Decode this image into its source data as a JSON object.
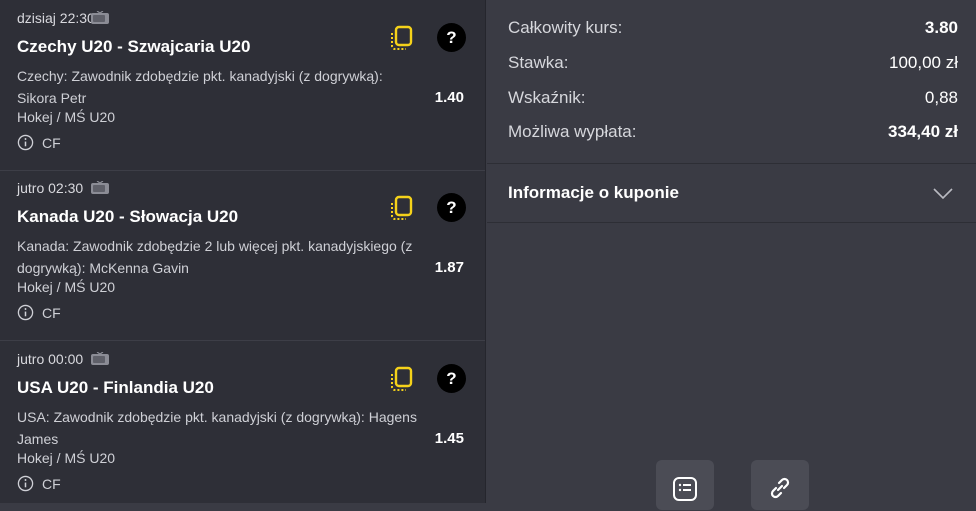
{
  "bets": [
    {
      "time": "dzisiaj 22:30",
      "title": "Czechy U20 - Szwajcaria U20",
      "desc": "Czechy: Zawodnik zdobędzie pkt. kanadyjski (z dogrywką): Sikora Petr",
      "odds": "1.40",
      "sport": "Hokej / MŚ U20",
      "cf": "CF"
    },
    {
      "time": "jutro 02:30",
      "title": "Kanada U20 - Słowacja U20",
      "desc": "Kanada: Zawodnik zdobędzie 2 lub więcej pkt. kanadyjskiego (z dogrywką): McKenna Gavin",
      "odds": "1.87",
      "sport": "Hokej / MŚ U20",
      "cf": "CF"
    },
    {
      "time": "jutro 00:00",
      "title": "USA U20 - Finlandia U20",
      "desc": "USA: Zawodnik zdobędzie pkt. kanadyjski (z dogrywką): Hagens James",
      "odds": "1.45",
      "sport": "Hokej / MŚ U20",
      "cf": "CF"
    }
  ],
  "summary": {
    "total_odds_label": "Całkowity kurs:",
    "total_odds_value": "3.80",
    "stake_label": "Stawka:",
    "stake_value": "100,00 zł",
    "indicator_label": "Wskaźnik:",
    "indicator_value": "0,88",
    "payout_label": "Możliwa wypłata:",
    "payout_value": "334,40 zł"
  },
  "coupon_info": {
    "title": "Informacje o kuponie"
  },
  "icons": {
    "tv": "tv-icon",
    "copy": "copy-bet-icon",
    "help": "question-mark-icon",
    "info": "info-circle-icon",
    "chevron": "chevron-down-icon",
    "list": "list-document-icon",
    "link": "link-icon"
  },
  "colors": {
    "left_bg": "#2e2f37",
    "right_bg": "#3a3b44",
    "accent_yellow": "#f5d21a"
  }
}
